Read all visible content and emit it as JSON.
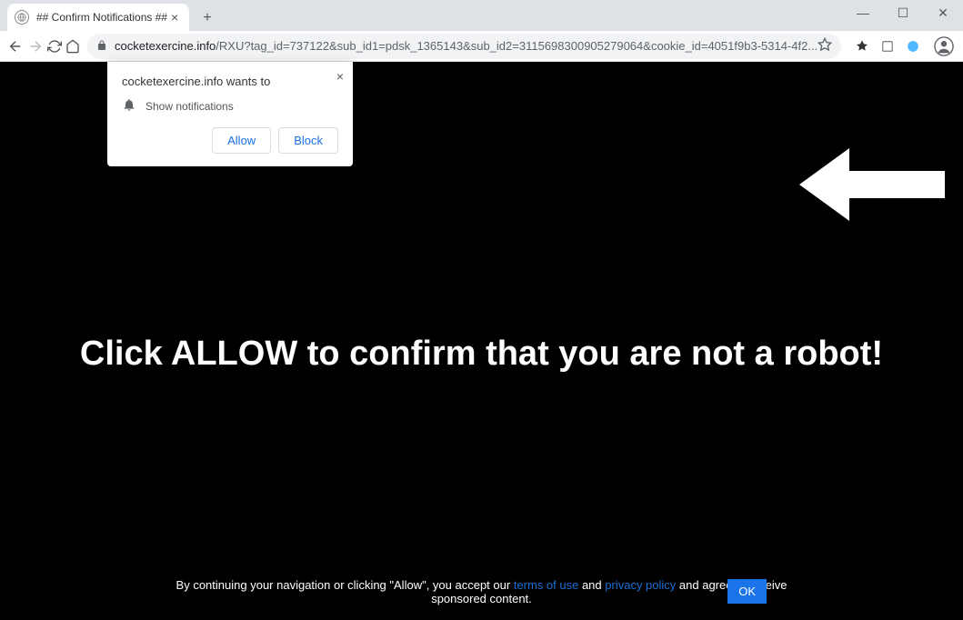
{
  "window": {
    "tab_title": "## Confirm Notifications ##"
  },
  "toolbar": {
    "url_host": "cocketexercine.info",
    "url_path": "/RXU?tag_id=737122&sub_id1=pdsk_1365143&sub_id2=3115698300905279064&cookie_id=4051f9b3-5314-4f2..."
  },
  "permission": {
    "title": "cocketexercine.info wants to",
    "line": "Show notifications",
    "allow": "Allow",
    "block": "Block"
  },
  "page": {
    "heading": "Click ALLOW to confirm that you are not a robot!",
    "footer_pre": "By continuing your navigation or clicking \"Allow\", you accept our ",
    "footer_terms": "terms of use",
    "footer_and": " and ",
    "footer_privacy": "privacy policy",
    "footer_post": " and agree to receive sponsored content.",
    "ok": "OK"
  }
}
